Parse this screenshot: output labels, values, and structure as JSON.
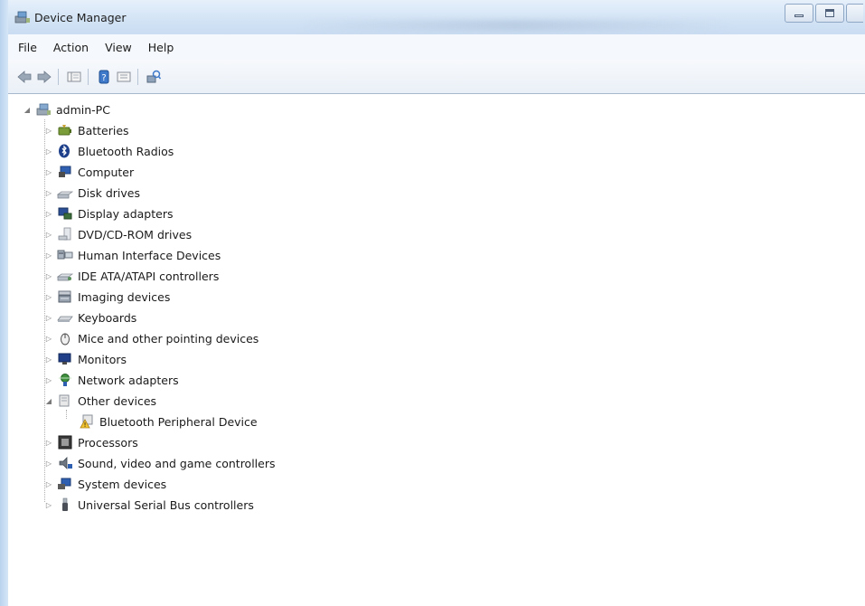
{
  "window": {
    "title": "Device Manager"
  },
  "menu": {
    "items": [
      "File",
      "Action",
      "View",
      "Help"
    ]
  },
  "toolbar": {
    "buttons": [
      "back-icon",
      "forward-icon",
      "show-hide-tree-icon",
      "help-icon",
      "properties-icon",
      "scan-hardware-icon"
    ]
  },
  "tree": {
    "root": "admin-PC",
    "categories": [
      {
        "label": "Batteries",
        "icon": "battery-icon",
        "expanded": false
      },
      {
        "label": "Bluetooth Radios",
        "icon": "bluetooth-icon",
        "expanded": false
      },
      {
        "label": "Computer",
        "icon": "computer-icon",
        "expanded": false
      },
      {
        "label": "Disk drives",
        "icon": "disk-drive-icon",
        "expanded": false
      },
      {
        "label": "Display adapters",
        "icon": "display-adapter-icon",
        "expanded": false
      },
      {
        "label": "DVD/CD-ROM drives",
        "icon": "dvd-drive-icon",
        "expanded": false
      },
      {
        "label": "Human Interface Devices",
        "icon": "hid-icon",
        "expanded": false
      },
      {
        "label": "IDE ATA/ATAPI controllers",
        "icon": "ide-controller-icon",
        "expanded": false
      },
      {
        "label": "Imaging devices",
        "icon": "imaging-device-icon",
        "expanded": false
      },
      {
        "label": "Keyboards",
        "icon": "keyboard-icon",
        "expanded": false
      },
      {
        "label": "Mice and other pointing devices",
        "icon": "mouse-icon",
        "expanded": false
      },
      {
        "label": "Monitors",
        "icon": "monitor-icon",
        "expanded": false
      },
      {
        "label": "Network adapters",
        "icon": "network-adapter-icon",
        "expanded": false
      },
      {
        "label": "Other devices",
        "icon": "other-devices-icon",
        "expanded": true,
        "children": [
          {
            "label": "Bluetooth Peripheral Device",
            "icon": "warning-device-icon"
          }
        ]
      },
      {
        "label": "Processors",
        "icon": "processor-icon",
        "expanded": false
      },
      {
        "label": "Sound, video and game controllers",
        "icon": "sound-icon",
        "expanded": false
      },
      {
        "label": "System devices",
        "icon": "system-devices-icon",
        "expanded": false
      },
      {
        "label": "Universal Serial Bus controllers",
        "icon": "usb-icon",
        "expanded": false
      }
    ]
  },
  "colors": {
    "titlebar": "#d2e3f5",
    "frame": "#b9d3ee",
    "text": "#1a1a1a"
  }
}
